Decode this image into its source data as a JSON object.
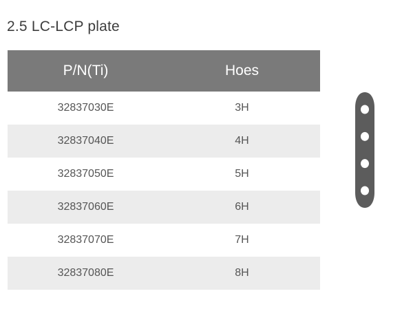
{
  "product": {
    "title": "2.5 LC-LCP plate"
  },
  "table": {
    "headers": {
      "part_number": "P/N(Ti)",
      "holes": "Hoes"
    },
    "rows": [
      {
        "part_number": "32837030E",
        "holes": "3H"
      },
      {
        "part_number": "32837040E",
        "holes": "4H"
      },
      {
        "part_number": "32837050E",
        "holes": "5H"
      },
      {
        "part_number": "32837060E",
        "holes": "6H"
      },
      {
        "part_number": "32837070E",
        "holes": "7H"
      },
      {
        "part_number": "32837080E",
        "holes": "8H"
      }
    ]
  },
  "figure": {
    "icon": "bone-plate-icon",
    "hole_count": 4,
    "plate_color": "#5c5c5c",
    "hole_color": "#ffffff"
  },
  "colors": {
    "header_background": "#7a7a7a",
    "stripe_background": "#ececec",
    "title_text": "#3d3d3d",
    "cell_text": "#555555"
  }
}
